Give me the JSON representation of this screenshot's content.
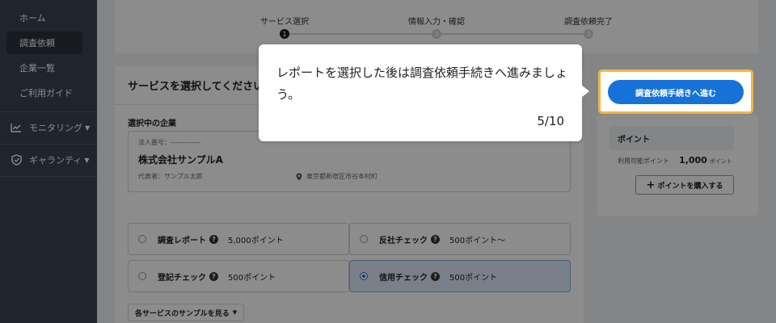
{
  "sidebar": {
    "items": [
      {
        "label": "ホーム"
      },
      {
        "label": "調査依頼"
      },
      {
        "label": "企業一覧"
      },
      {
        "label": "ご利用ガイド"
      }
    ],
    "groups": [
      {
        "label": "モニタリング",
        "icon": "chart-icon"
      },
      {
        "label": "ギャランティ",
        "icon": "shield-icon"
      }
    ]
  },
  "stepper": {
    "steps": [
      {
        "label": "サービス選択",
        "number": "1"
      },
      {
        "label": "情報入力・確認",
        "number": "2"
      },
      {
        "label": "調査依頼完了",
        "number": "3"
      }
    ]
  },
  "main": {
    "title": "サービスを選択してください",
    "selected_company_label": "選択中の企業",
    "company": {
      "corp_number": "法人番号：-------------",
      "name": "株式会社サンプルA",
      "representative": "代表者：サンプル太郎",
      "address": "東京都新宿区市谷本村町"
    },
    "options": [
      {
        "name": "調査レポート",
        "points": "5,000ポイント"
      },
      {
        "name": "反社チェック",
        "points": "500ポイント〜"
      },
      {
        "name": "登記チェック",
        "points": "500ポイント"
      },
      {
        "name": "信用チェック",
        "points": "500ポイント"
      }
    ],
    "sample_button": "各サービスのサンプルを見る"
  },
  "right": {
    "proceed_button": "調査依頼手続きへ進む",
    "points_title": "ポイント",
    "available_label": "利用可能ポイント",
    "available_value": "1,000",
    "available_unit": "ポイント",
    "buy_button": "ポイントを購入する"
  },
  "tooltip": {
    "text": "レポートを選択した後は調査依頼手続きへ進みましょう。",
    "counter": "5/10"
  },
  "colors": {
    "primary": "#1672d8",
    "highlight": "#f2b640",
    "sidebar": "#3b4250"
  }
}
